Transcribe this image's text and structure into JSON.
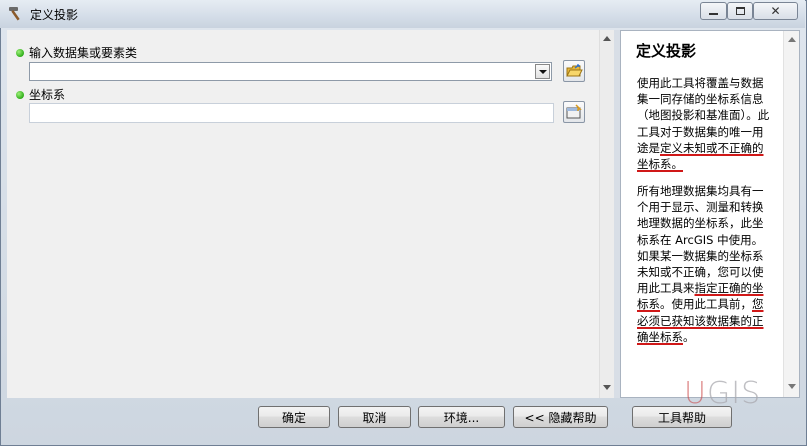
{
  "window": {
    "title": "定义投影",
    "title_icon": "hammer-icon",
    "minimize": "▭",
    "maximize": "▫",
    "close": "✕"
  },
  "params": {
    "input_label": "输入数据集或要素类",
    "input_value": "",
    "browse_icon": "open-folder-icon",
    "crs_label": "坐标系",
    "crs_value": "",
    "crs_icon": "spatial-reference-properties-icon",
    "required_dot_color": "#2fae1a"
  },
  "help": {
    "title": "定义投影",
    "p1_text": "使用此工具将覆盖与数据集一同存储的坐标系信息（地图投影和基准面）。此工具对于数据集的唯一用途是",
    "p1_emph": "定义未知或不正确的坐标系。",
    "p2_a": "所有地理数据集均具有一个用于显示、测量和转换地理数据的坐标系，此坐标系在 ArcGIS 中使用。如果某一数据集的坐标系未知或不正确，您可以使用此工具来",
    "p2_b": "指定正确的坐标系",
    "p2_c": "。使用此工具前，",
    "p2_d": "您必须已获知该数据集的正确坐标系",
    "p2_e": "。",
    "underline_color": "#d01818"
  },
  "buttons": {
    "ok": "确定",
    "cancel": "取消",
    "env": "环境...",
    "hide_help": "<< 隐藏帮助",
    "tool_help": "工具帮助"
  },
  "watermark": {
    "u": "U",
    "gis": "GIS"
  }
}
